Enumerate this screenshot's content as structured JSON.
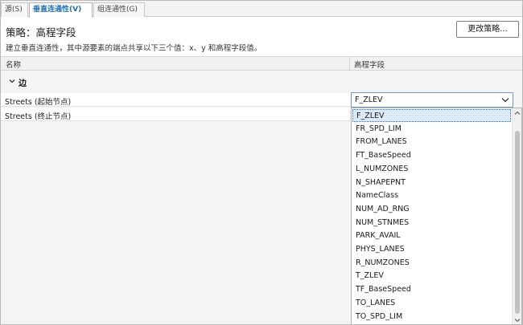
{
  "tabs": [
    {
      "label": "源(S)"
    },
    {
      "label": "垂直连通性(V)"
    },
    {
      "label": "组连通性(G)"
    }
  ],
  "policy": {
    "title": "策略：高程字段",
    "description": "建立垂直连通性，其中源要素的端点共享以下三个值：x、y 和高程字段值。",
    "change_button": "更改策略..."
  },
  "columns": {
    "name": "名称",
    "elevation": "高程字段"
  },
  "group": {
    "label": "边"
  },
  "rows": [
    {
      "label": "Streets (起始节点)"
    },
    {
      "label": "Streets (终止节点)"
    }
  ],
  "combo": {
    "value": "F_ZLEV"
  },
  "dropdown": {
    "options": [
      "F_ZLEV",
      "FR_SPD_LIM",
      "FROM_LANES",
      "FT_BaseSpeed",
      "L_NUMZONES",
      "N_SHAPEPNT",
      "NameClass",
      "NUM_AD_RNG",
      "NUM_STNMES",
      "PARK_AVAIL",
      "PHYS_LANES",
      "R_NUMZONES",
      "T_ZLEV",
      "TF_BaseSpeed",
      "TO_LANES",
      "TO_SPD_LIM"
    ],
    "selected_index": 0
  },
  "icons": {
    "group_toggle": "chevron-down-icon",
    "combo_arrow": "chevron-down-icon",
    "scroll_up": "scroll-up-arrow-icon",
    "scroll_down": "scroll-down-arrow-icon"
  },
  "colors": {
    "accent": "#1f6fb4",
    "selection": "#dce9f7",
    "focus_border": "#6e9bd6"
  }
}
